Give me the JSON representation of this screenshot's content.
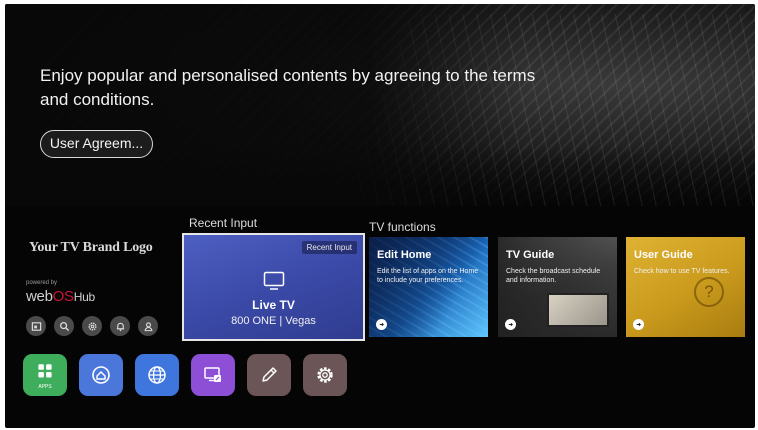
{
  "banner": {
    "message": "Enjoy popular and personalised contents by agreeing to the terms and conditions.",
    "button_label": "User Agreem..."
  },
  "brand": {
    "logo_text": "Your TV Brand Logo",
    "powered_by": "powered by",
    "webos_prefix": "web",
    "webos_os": "OS",
    "webos_hub": "Hub"
  },
  "quick_icons": [
    "picture-icon",
    "search-icon",
    "settings-icon",
    "notification-icon",
    "account-icon"
  ],
  "apps": [
    {
      "name": "apps-launcher",
      "label": "APPS",
      "color": "#3fae5c"
    },
    {
      "name": "home-app",
      "label": "",
      "color": "#4a77d9"
    },
    {
      "name": "web-browser-app",
      "label": "",
      "color": "#3f76dd"
    },
    {
      "name": "screen-share-app",
      "label": "",
      "color": "#8c4fd6"
    },
    {
      "name": "edit-app",
      "label": "",
      "color": "#6b5556"
    },
    {
      "name": "settings-app",
      "label": "",
      "color": "#6b5556"
    }
  ],
  "recent_input": {
    "section_label": "Recent Input",
    "badge": "Recent Input",
    "title": "Live TV",
    "subtitle": "800 ONE | Vegas"
  },
  "tv_functions": {
    "section_label": "TV functions",
    "cards": [
      {
        "title": "Edit Home",
        "description": "Edit the list of apps on the Home to include your preferences."
      },
      {
        "title": "TV Guide",
        "description": "Check the broadcast schedule and information."
      },
      {
        "title": "User Guide",
        "description": "Check how to use TV features."
      }
    ]
  }
}
